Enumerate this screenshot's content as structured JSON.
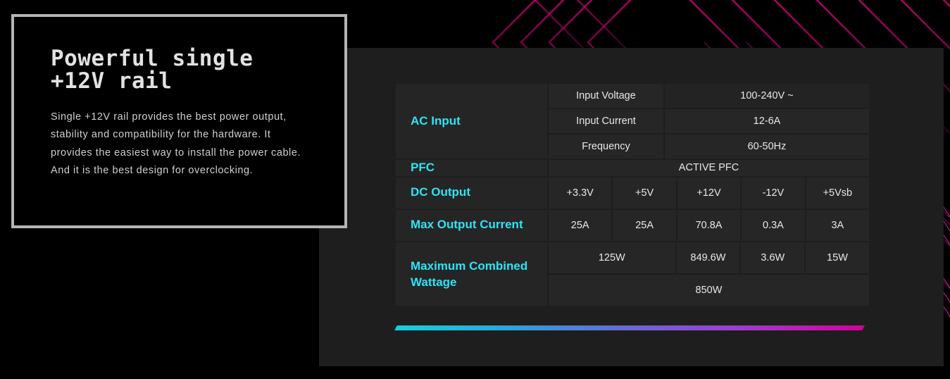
{
  "feature": {
    "title": "Powerful single\n+12V rail",
    "description": "Single +12V rail provides the best power output, stability and compatibility for the hardware. It provides the easiest way to install the power cable. And it is the best design for overclocking."
  },
  "colors": {
    "accent_cyan": "#2fe3f5",
    "accent_magenta": "#d4009a",
    "panel_bg": "#1e1e1e",
    "cell_bg": "#262626",
    "card_border": "#b4b4b4"
  },
  "spec_table": {
    "rows": [
      {
        "label": "AC Input",
        "sub_rows": [
          {
            "name": "Input Voltage",
            "value": "100-240V ~"
          },
          {
            "name": "Input Current",
            "value": "12-6A"
          },
          {
            "name": "Frequency",
            "value": "60-50Hz"
          }
        ]
      },
      {
        "label": "PFC",
        "value": "ACTIVE PFC"
      },
      {
        "label": "DC Output",
        "cells": [
          "+3.3V",
          "+5V",
          "+12V",
          "-12V",
          "+5Vsb"
        ]
      },
      {
        "label": "Max Output Current",
        "cells": [
          "25A",
          "25A",
          "70.8A",
          "0.3A",
          "3A"
        ]
      },
      {
        "label": "Maximum Combined Wattage",
        "cells": [
          "125W",
          "849.6W",
          "3.6W",
          "15W"
        ],
        "total": "850W"
      }
    ]
  }
}
